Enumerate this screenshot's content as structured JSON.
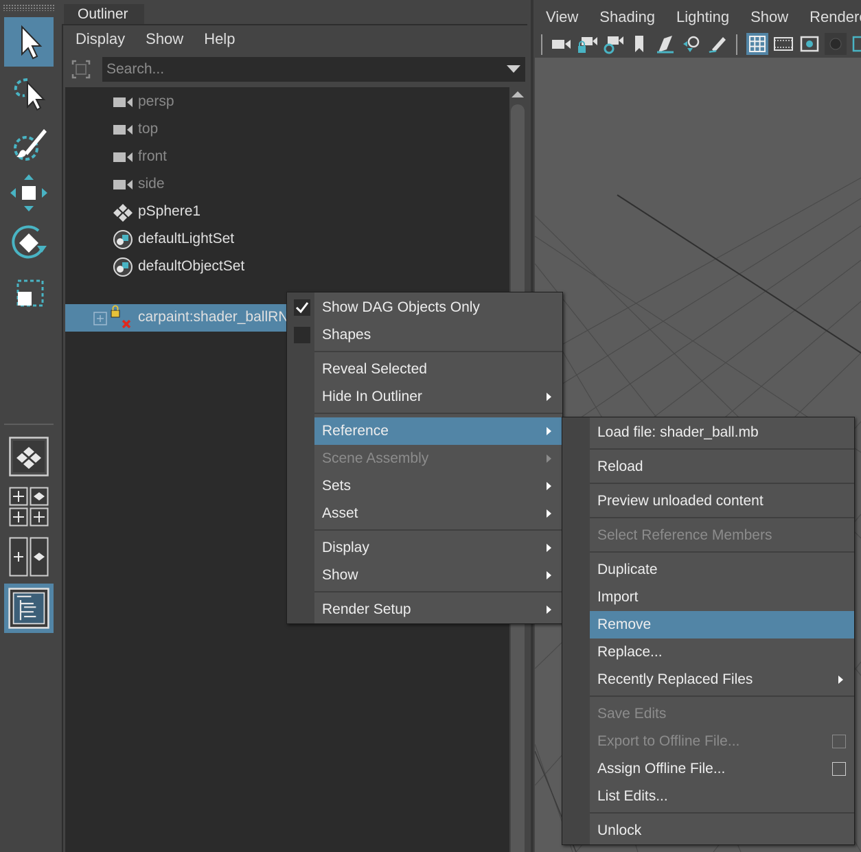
{
  "toolbox": {
    "tools": [
      "select-tool-icon",
      "lasso-tool-icon",
      "paint-select-tool-icon",
      "move-tool-icon",
      "rotate-tool-icon",
      "scale-tool-icon"
    ],
    "active_tool": "select-tool-icon",
    "layouts": [
      "single-perspective-layout-icon",
      "four-view-layout-icon",
      "two-pane-layout-icon",
      "outliner-layout-icon"
    ],
    "active_layout": "outliner-layout-icon"
  },
  "outliner": {
    "tab_title": "Outliner",
    "menu": [
      "Display",
      "Show",
      "Help"
    ],
    "search_placeholder": "Search...",
    "items": [
      {
        "label": "persp",
        "icon": "camera-icon",
        "dim": true
      },
      {
        "label": "top",
        "icon": "camera-icon",
        "dim": true
      },
      {
        "label": "front",
        "icon": "camera-icon",
        "dim": true
      },
      {
        "label": "side",
        "icon": "camera-icon",
        "dim": true
      },
      {
        "label": "pSphere1",
        "icon": "mesh-transform-icon",
        "dim": false
      },
      {
        "label": "defaultLightSet",
        "icon": "object-set-icon",
        "dim": false
      },
      {
        "label": "defaultObjectSet",
        "icon": "object-set-icon",
        "dim": false
      },
      {
        "label": "carpaint:shader_ballRN",
        "icon": "locked-reference-icon",
        "dim": false,
        "selected": true
      }
    ]
  },
  "viewport": {
    "menu": [
      "View",
      "Shading",
      "Lighting",
      "Show",
      "Renderer"
    ]
  },
  "context_menu": {
    "items": [
      {
        "label": "Show DAG Objects Only",
        "checkbox": true,
        "checked": true
      },
      {
        "label": "Shapes",
        "checkbox": true,
        "checked": false
      },
      {
        "label": "Reveal Selected"
      },
      {
        "label": "Hide In Outliner",
        "submenu": true
      },
      {
        "label": "Reference",
        "submenu": true,
        "highlighted": true
      },
      {
        "label": "Scene Assembly",
        "submenu": true,
        "disabled": true
      },
      {
        "label": "Sets",
        "submenu": true
      },
      {
        "label": "Asset",
        "submenu": true
      },
      {
        "label": "Display",
        "submenu": true
      },
      {
        "label": "Show",
        "submenu": true
      },
      {
        "label": "Render Setup",
        "submenu": true
      }
    ]
  },
  "reference_submenu": {
    "items": [
      {
        "label": "Load file: shader_ball.mb"
      },
      {
        "label": "Reload"
      },
      {
        "label": "Preview unloaded content"
      },
      {
        "label": "Select Reference Members",
        "disabled": true
      },
      {
        "label": "Duplicate"
      },
      {
        "label": "Import"
      },
      {
        "label": "Remove",
        "highlighted": true
      },
      {
        "label": "Replace..."
      },
      {
        "label": "Recently Replaced Files",
        "submenu": true
      },
      {
        "label": "Save Edits",
        "disabled": true
      },
      {
        "label": "Export to Offline File...",
        "disabled": true,
        "option_box": true
      },
      {
        "label": "Assign Offline File...",
        "option_box": true
      },
      {
        "label": "List Edits..."
      },
      {
        "label": "Unlock"
      }
    ]
  },
  "colors": {
    "selection": "#5285a6",
    "panel": "#444444",
    "tree_bg": "#2b2b2b",
    "menu_bg": "#525252",
    "viewport_bg": "#5c5c5c"
  }
}
